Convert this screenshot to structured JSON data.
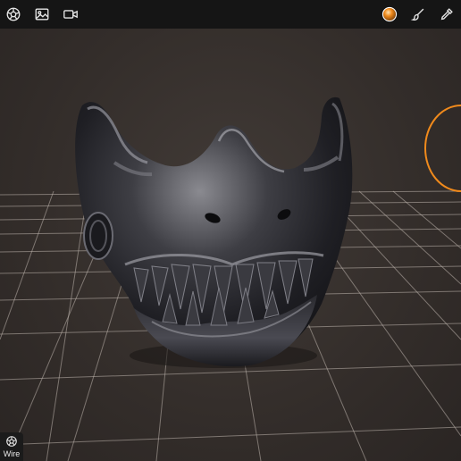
{
  "toolbar": {
    "left_icons": [
      "sculpt-app-icon",
      "image-icon",
      "video-camera-icon"
    ],
    "right_icons": [
      "material-sphere-icon",
      "brush-icon",
      "eyedropper-icon"
    ],
    "material_color": "#f08a1c"
  },
  "bottom_left": {
    "wire_label": "Wire",
    "icon": "wireframe-sphere-icon"
  },
  "scene": {
    "object": "3d-mask-model",
    "grid": true,
    "background_color": "#332d2a",
    "gizmo_color": "#f08a1c"
  }
}
